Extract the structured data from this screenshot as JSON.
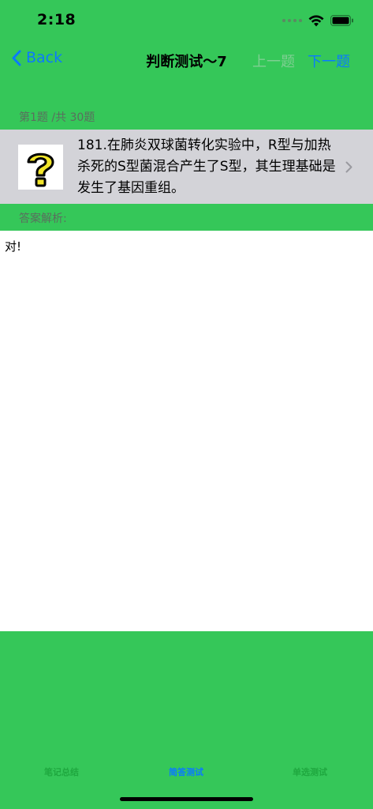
{
  "status_bar": {
    "time": "2:18"
  },
  "nav": {
    "back_label": "Back",
    "title": "判断测试～7",
    "prev_label": "上一题",
    "next_label": "下一题"
  },
  "question": {
    "counter": "第1题 /共 30题",
    "text": "181.在肺炎双球菌转化实验中，R型与加热杀死的S型菌混合产生了S型，其生理基础是发生了基因重组。"
  },
  "answer": {
    "label": "答案解析:",
    "text": "对!"
  },
  "tabs": [
    {
      "label": "笔记总结"
    },
    {
      "label": "简答测试"
    },
    {
      "label": "单选测试"
    }
  ],
  "colors": {
    "background_green": "#35c759",
    "accent_blue": "#0a7aff",
    "question_row_gray": "#d3d3d8"
  },
  "icons": {
    "question": "question-mark-icon",
    "back": "chevron-left-icon",
    "row": "chevron-right-icon"
  }
}
